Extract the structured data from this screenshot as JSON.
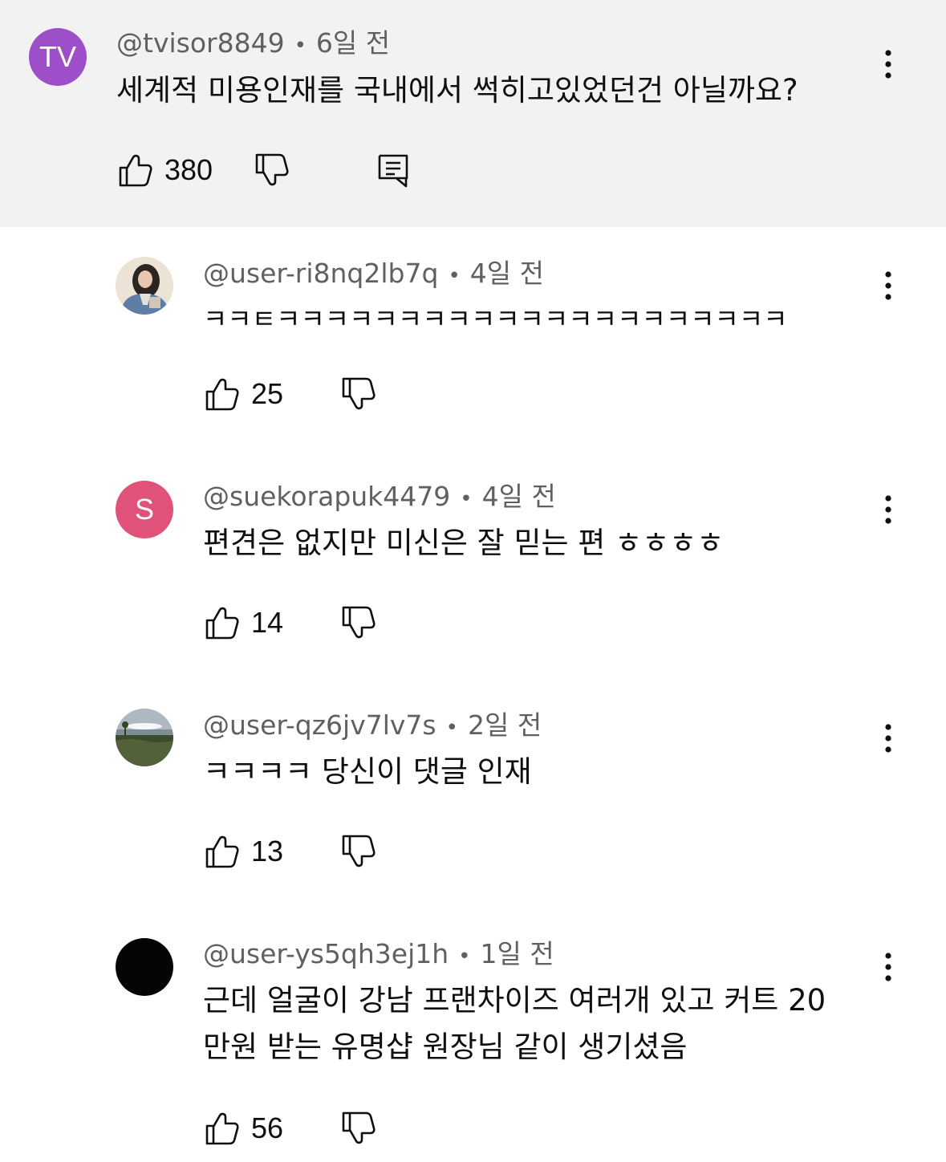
{
  "comments": [
    {
      "avatar_text": "TV",
      "avatar_color": "#9c4fc9",
      "username": "@tvisor8849",
      "time": "6일 전",
      "text": "세계적 미용인재를 국내에서 썩히고있었던건 아닐까요?",
      "likes": "380"
    },
    {
      "avatar_text": "",
      "username": "@user-ri8nq2lb7q",
      "time": "4일 전",
      "text": "ㅋㅋㅌㅋㅋㅋㅋㅋㅋㅋㅋㅋㅋㅋㅋㅋㅋㅋㅋㅋㅋㅋㅋㅋ",
      "likes": "25"
    },
    {
      "avatar_text": "S",
      "avatar_color": "#e0527a",
      "username": "@suekorapuk4479",
      "time": "4일 전",
      "text": "편견은 없지만 미신은 잘 믿는 편 ㅎㅎㅎㅎ",
      "likes": "14"
    },
    {
      "avatar_text": "",
      "username": "@user-qz6jv7lv7s",
      "time": "2일 전",
      "text": "ㅋㅋㅋㅋ 당신이 댓글 인재",
      "likes": "13"
    },
    {
      "avatar_text": "",
      "username": "@user-ys5qh3ej1h",
      "time": "1일 전",
      "text_line1": "근데 얼굴이 강남 프랜차이즈 여러개 있고 커트 20",
      "text_line2": "만원 받는 유명샵 원장님 같이 생기셨음",
      "likes": "56"
    }
  ],
  "separator": "•"
}
